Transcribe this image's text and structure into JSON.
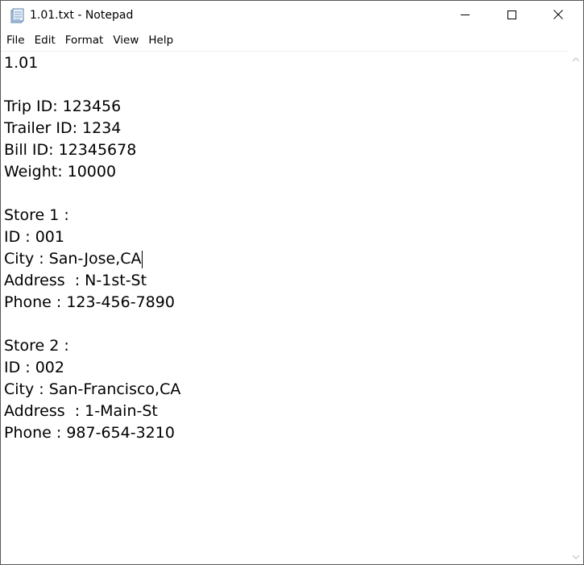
{
  "window": {
    "title": "1.01.txt - Notepad",
    "app_icon": "notepad-icon"
  },
  "menu": {
    "items": [
      {
        "label": "File"
      },
      {
        "label": "Edit"
      },
      {
        "label": "Format"
      },
      {
        "label": "View"
      },
      {
        "label": "Help"
      }
    ]
  },
  "document": {
    "lines": [
      "1.01",
      "",
      "Trip ID: 123456",
      "Trailer ID: 1234",
      "Bill ID: 12345678",
      "Weight: 10000",
      "",
      "Store 1 :",
      "ID : 001",
      "City : San-Jose,CA",
      "Address  : N-1st-St",
      "Phone : 123-456-7890",
      "",
      "Store 2 :",
      "ID : 002",
      "City : San-Francisco,CA",
      "Address  : 1-Main-St",
      "Phone : 987-654-3210"
    ]
  },
  "icons": {
    "minimize": "minimize-icon",
    "maximize": "maximize-icon",
    "close": "close-icon",
    "scroll_up": "chevron-up-icon",
    "scroll_down": "chevron-down-icon"
  }
}
